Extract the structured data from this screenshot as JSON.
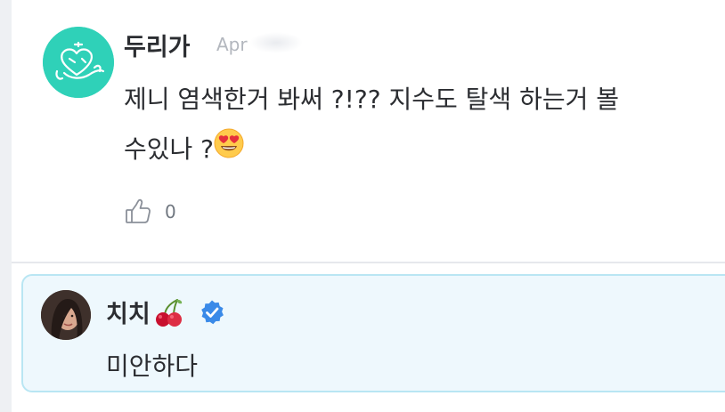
{
  "comment": {
    "author": "두리가",
    "date_fragment": "Apr",
    "text_line1": "제니 염색한거 봐써 ?!?? 지수도 탈색 하는거 볼",
    "text_line2": "수있나 ?",
    "emoji": "heart-eyes-emoji",
    "likes": "0"
  },
  "reply": {
    "author": "치치",
    "author_emoji": "cherries-emoji",
    "verified": true,
    "text": "미안하다"
  },
  "colors": {
    "avatar_main": "#2fd1b8",
    "reply_bg": "#eef8fd",
    "reply_border": "#b9e6f3",
    "verified_blue": "#3a8ae8"
  }
}
